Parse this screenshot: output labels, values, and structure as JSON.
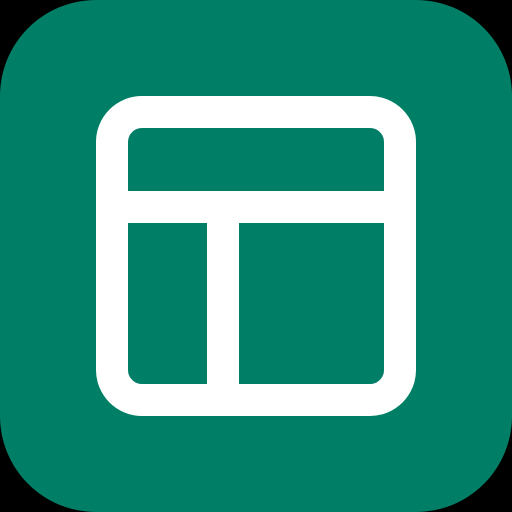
{
  "app_icon": {
    "icon": "layout-dashboard-icon",
    "background_color": "#007E66",
    "glyph_color": "#FFFFFF",
    "outer_background": "#000000"
  }
}
